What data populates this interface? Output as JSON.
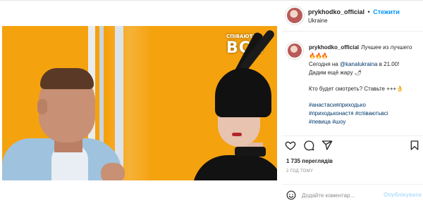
{
  "header": {
    "username": "prykhodko_official",
    "separator": "•",
    "follow_label": "Стежити",
    "location": "Ukraine"
  },
  "video": {
    "overlay_logo_small": "СПІВАЮТЬ",
    "overlay_logo": "ВСІ!",
    "mute_icon": "speaker-icon"
  },
  "caption": {
    "username": "prykhodko_official",
    "intro": "Лучшее из лучшего",
    "fire_emoji": "🔥🔥🔥",
    "line2_prefix": "Сегодня на ",
    "mention": "@kanalukraina",
    "line2_suffix": " в 21.00!",
    "line3": "Дадим ещё жару 🌶",
    "line4": "Кто будет смотреть? Ставьте +++👌",
    "hashtags_line1": "#анастасияприходько",
    "hashtags_line2": "#приходьконастя #співаютьвсі",
    "hashtags_line3": "#певица #шоу"
  },
  "actions": {
    "icons": [
      "heart-icon",
      "comment-icon",
      "share-icon",
      "bookmark-icon"
    ]
  },
  "stats": {
    "views": "1 735 переглядів",
    "time_ago": "2 ГОД ТОМУ"
  },
  "comment": {
    "placeholder": "Додайте коментар...",
    "post_label": "Опублікувати"
  },
  "colors": {
    "accent": "#0095f6",
    "link": "#00376b",
    "post_disabled": "#b2dffc",
    "video_bg": "#f5a20f"
  }
}
